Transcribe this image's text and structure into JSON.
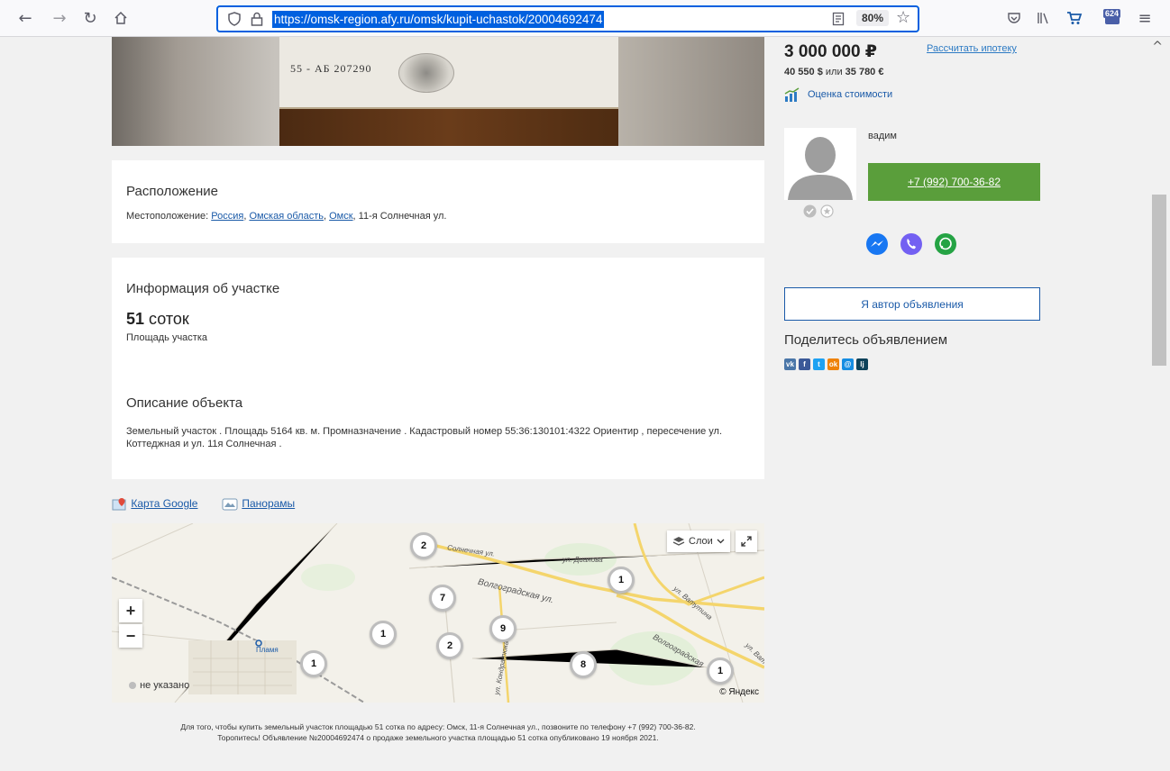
{
  "browser": {
    "url": "https://omsk-region.afy.ru/omsk/kupit-uchastok/20004692474",
    "zoom": "80%",
    "downloads_badge": "624"
  },
  "location": {
    "title": "Расположение",
    "label": "Местоположение: ",
    "links": [
      "Россия",
      "Омская область",
      "Омск"
    ],
    "separator": ", ",
    "street": ", 11-я Солнечная ул."
  },
  "plot_info": {
    "title": "Информация об участке",
    "area_value": "51",
    "area_unit": " соток",
    "area_caption": "Площадь участка"
  },
  "description": {
    "title": "Описание объекта",
    "text": "Земельный участок . Площадь 5164 кв. м. Промназначение . Кадастровый номер 55:36:130101:4322 Ориентир , пересечение ул. Коттеджная и ул. 11я Солнечная ."
  },
  "photo": {
    "serial": "55 - АБ  207290"
  },
  "sidebar": {
    "price": "3 000 000 ₽",
    "mortgage_link": "Рассчитать ипотеку",
    "usd": "40 550 $",
    "or": " или ",
    "eur": "35 780 €",
    "evaluation": "Оценка стоимости",
    "seller_name": "вадим",
    "phone": "+7 (992) 700-36-82",
    "author_button": "Я автор объявления",
    "share_title": "Поделитесь объявлением",
    "share_networks": [
      "vk",
      "facebook",
      "twitter",
      "odnoklassniki",
      "mail.ru",
      "livejournal"
    ]
  },
  "map": {
    "google_link": "Карта Google",
    "panorama_link": "Панорамы",
    "layers_label": "Слои",
    "legend": "не указано",
    "copyright": "© Яндекс",
    "place_label": "Пламя",
    "streets": [
      "Солнечная ул.",
      "ул. Дианова",
      "Волгоградская ул.",
      "ул. Ватутина",
      "Волгоградская",
      "ул. Кондратюка",
      "ул. Ват"
    ],
    "clusters": [
      "2",
      "1",
      "7",
      "1",
      "9",
      "2",
      "1",
      "8",
      "1"
    ]
  },
  "footer": {
    "line1": "Для того, чтобы купить земельный участок площадью 51 сотка по адресу: Омск, 11-я Солнечная ул., позвоните по телефону +7 (992) 700-36-82.",
    "line2": "Торопитесь! Объявление №20004692474 о продаже земельного участка площадью 51 сотка опубликовано 19 ноября 2021."
  }
}
